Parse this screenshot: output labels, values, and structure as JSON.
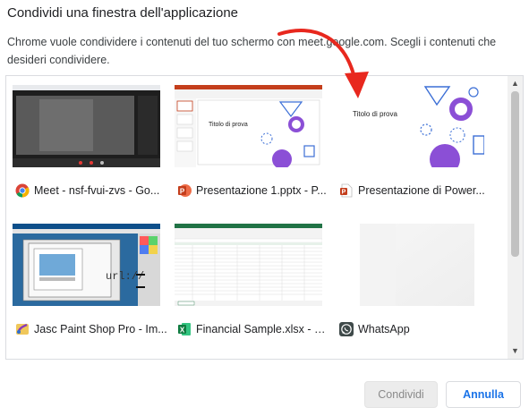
{
  "dialog": {
    "title": "Condividi una finestra dell'applicazione",
    "description": "Chrome vuole condividere i contenuti del tuo schermo con meet.google.com. Scegli i contenuti che desideri condividere."
  },
  "windows": [
    {
      "label": "Meet - nsf-fvui-zvs - Go...",
      "icon": "chrome-icon"
    },
    {
      "label": "Presentazione 1.pptx - P...",
      "icon": "powerpoint-icon"
    },
    {
      "label": "Presentazione di Power...",
      "icon": "powerpoint-doc-icon",
      "thumb_title": "Titolo di prova"
    },
    {
      "label": "Jasc Paint Shop Pro - Im...",
      "icon": "paint-shop-pro-icon"
    },
    {
      "label": "Financial Sample.xlsx - E...",
      "icon": "excel-icon"
    },
    {
      "label": "WhatsApp",
      "icon": "whatsapp-icon"
    }
  ],
  "ppt_thumb_title": "Titolo di prova",
  "buttons": {
    "share": "Condividi",
    "cancel": "Annulla"
  },
  "colors": {
    "accent": "#1a73e8",
    "annotation_arrow": "#e8281e",
    "slide_purple": "#8b4fd6",
    "slide_blue": "#3c6fd6"
  }
}
